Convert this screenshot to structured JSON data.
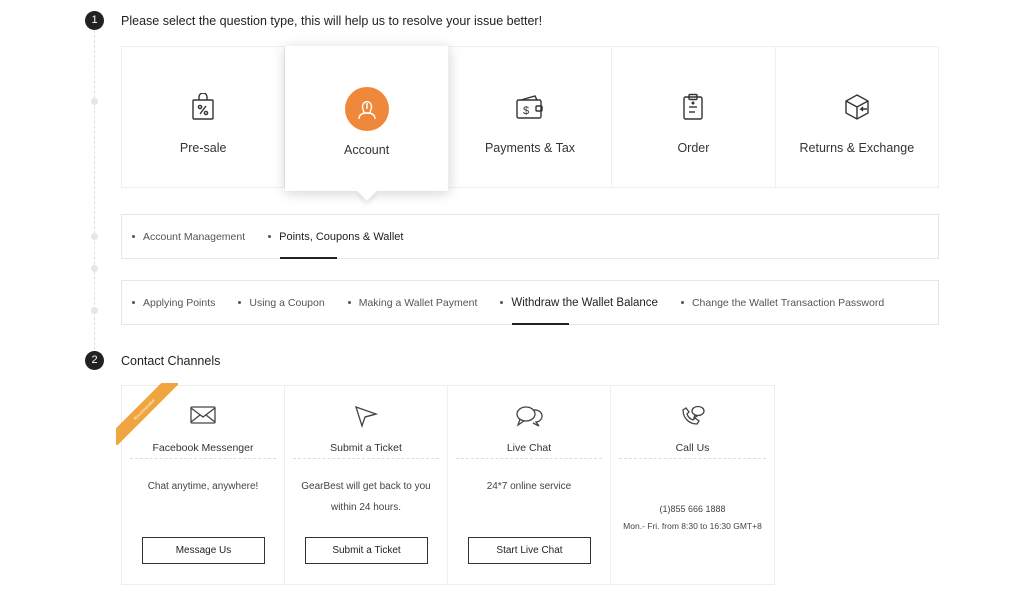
{
  "steps": {
    "one": {
      "num": "1",
      "title": "Please select the question type, this will help us to resolve your issue better!"
    },
    "two": {
      "num": "2",
      "title": "Contact Channels"
    }
  },
  "question_types": [
    {
      "label": "Pre-sale",
      "icon": "shopping-bag-percent-icon"
    },
    {
      "label": "Account",
      "icon": "user-account-icon"
    },
    {
      "label": "Payments & Tax",
      "icon": "wallet-dollar-icon"
    },
    {
      "label": "Order",
      "icon": "clipboard-order-icon"
    },
    {
      "label": "Returns & Exchange",
      "icon": "box-return-icon"
    }
  ],
  "account_subtopics": [
    "Account Management",
    "Points, Coupons & Wallet"
  ],
  "wallet_topics": [
    "Applying Points",
    "Using a Coupon",
    "Making a Wallet Payment",
    "Withdraw the Wallet Balance",
    "Change the Wallet Transaction Password"
  ],
  "channels": {
    "messenger": {
      "ribbon": "Recommended",
      "name": "Facebook Messenger",
      "desc": "Chat anytime, anywhere!",
      "button": "Message Us"
    },
    "ticket": {
      "name": "Submit a Ticket",
      "desc": "GearBest will get back to you within 24 hours.",
      "button": "Submit a Ticket"
    },
    "live_chat": {
      "name": "Live Chat",
      "desc": "24*7 online service",
      "button": "Start Live Chat"
    },
    "call": {
      "name": "Call Us",
      "phone": "(1)855 666 1888",
      "hours": "Mon.- Fri. from 8:30 to 16:30 GMT+8"
    }
  },
  "colors": {
    "accent": "#f0883c",
    "ribbon": "#f0a640",
    "dark": "#222222"
  }
}
